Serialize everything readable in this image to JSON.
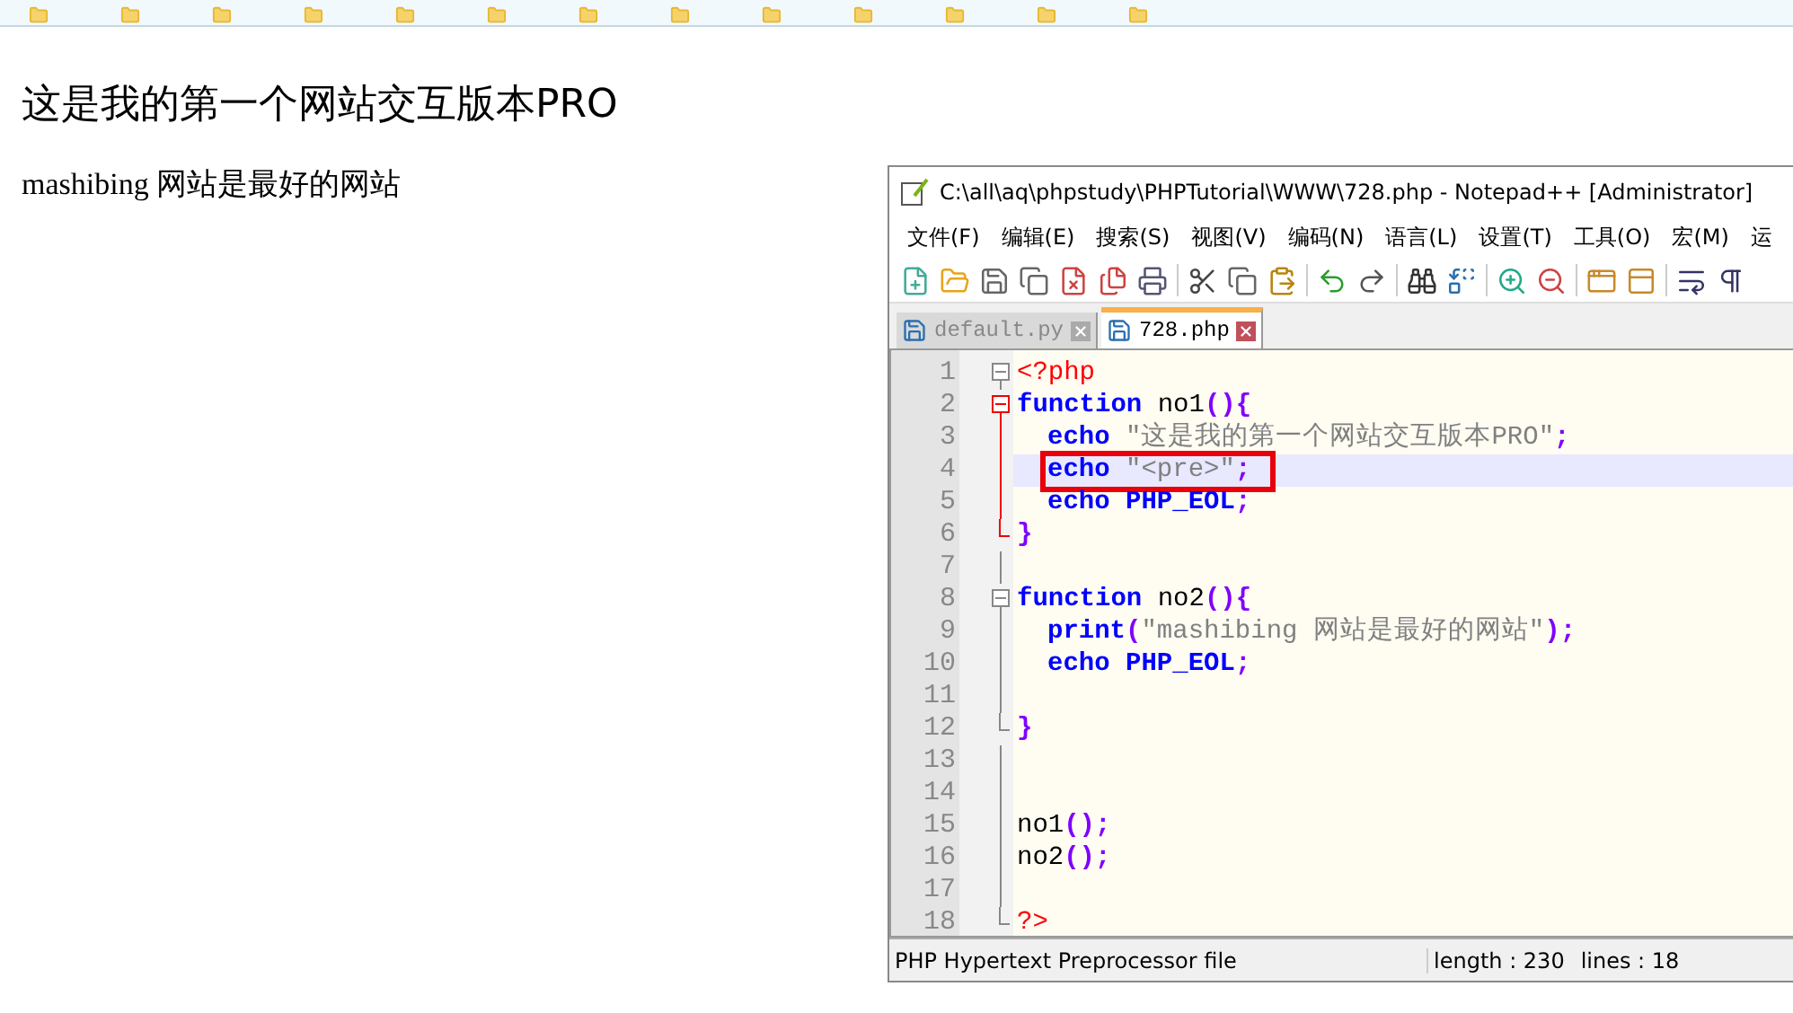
{
  "page": {
    "heading": "这是我的第一个网站交互版本PRO",
    "paragraph": "mashibing 网站是最好的网站"
  },
  "editor_window": {
    "title": "C:\\all\\aq\\phpstudy\\PHPTutorial\\WWW\\728.php - Notepad++ [Administrator]",
    "menu": [
      "文件(F)",
      "编辑(E)",
      "搜索(S)",
      "视图(V)",
      "编码(N)",
      "语言(L)",
      "设置(T)",
      "工具(O)",
      "宏(M)",
      "运"
    ],
    "tabs": [
      {
        "label": "default.py",
        "selected": false
      },
      {
        "label": "728.php",
        "selected": true
      }
    ],
    "lines": [
      {
        "number": "1",
        "selected": false,
        "kind": "start",
        "tokens": [
          {
            "text": "<?php",
            "kind": "tag"
          }
        ]
      },
      {
        "number": "2",
        "selected": false,
        "kind": "start",
        "fold_active": true,
        "tokens": [
          {
            "text": "function",
            "kind": "keyword"
          },
          {
            "text": " no1",
            "kind": "name"
          },
          {
            "text": "(){",
            "kind": "punct"
          }
        ]
      },
      {
        "number": "3",
        "selected": false,
        "kind": "body",
        "fold_active": true,
        "indent": true,
        "tokens": [
          {
            "text": "echo",
            "kind": "keyword"
          },
          {
            "text": " \"这是我的第一个网站交互版本PRO\"",
            "kind": "string"
          },
          {
            "text": ";",
            "kind": "punct"
          }
        ]
      },
      {
        "number": "4",
        "selected": true,
        "kind": "body",
        "fold_active": true,
        "indent": true,
        "annotated": true,
        "tokens": [
          {
            "text": "echo",
            "kind": "keyword"
          },
          {
            "text": " \"<pre>\"",
            "kind": "string"
          },
          {
            "text": ";",
            "kind": "punct"
          }
        ]
      },
      {
        "number": "5",
        "selected": false,
        "kind": "body",
        "fold_active": true,
        "indent": true,
        "tokens": [
          {
            "text": "echo",
            "kind": "keyword"
          },
          {
            "text": " PHP_EOL",
            "kind": "constant"
          },
          {
            "text": ";",
            "kind": "punct"
          }
        ]
      },
      {
        "number": "6",
        "selected": false,
        "kind": "end",
        "fold_active": true,
        "tokens": [
          {
            "text": "}",
            "kind": "punct"
          }
        ]
      },
      {
        "number": "7",
        "selected": false,
        "kind": "body"
      },
      {
        "number": "8",
        "selected": false,
        "kind": "start",
        "tokens": [
          {
            "text": "function",
            "kind": "keyword"
          },
          {
            "text": " no2",
            "kind": "name"
          },
          {
            "text": "(){",
            "kind": "punct"
          }
        ]
      },
      {
        "number": "9",
        "selected": false,
        "kind": "body",
        "indent": true,
        "tokens": [
          {
            "text": "print",
            "kind": "keyword"
          },
          {
            "text": "(",
            "kind": "punct"
          },
          {
            "text": "\"mashibing 网站是最好的网站\"",
            "kind": "string"
          },
          {
            "text": ");",
            "kind": "punct"
          }
        ]
      },
      {
        "number": "10",
        "selected": false,
        "kind": "body",
        "indent": true,
        "tokens": [
          {
            "text": "echo",
            "kind": "keyword"
          },
          {
            "text": " PHP_EOL",
            "kind": "constant"
          },
          {
            "text": ";",
            "kind": "punct"
          }
        ]
      },
      {
        "number": "11",
        "selected": false,
        "kind": "body"
      },
      {
        "number": "12",
        "selected": false,
        "kind": "end",
        "tokens": [
          {
            "text": "}",
            "kind": "punct"
          }
        ]
      },
      {
        "number": "13",
        "selected": false,
        "kind": "body"
      },
      {
        "number": "14",
        "selected": false,
        "kind": "body"
      },
      {
        "number": "15",
        "selected": false,
        "kind": "body",
        "tokens": [
          {
            "text": "no1",
            "kind": "name"
          },
          {
            "text": "();",
            "kind": "punct"
          }
        ]
      },
      {
        "number": "16",
        "selected": false,
        "kind": "body",
        "tokens": [
          {
            "text": "no2",
            "kind": "name"
          },
          {
            "text": "();",
            "kind": "punct"
          }
        ]
      },
      {
        "number": "17",
        "selected": false,
        "kind": "body"
      },
      {
        "number": "18",
        "selected": false,
        "kind": "end",
        "tokens": [
          {
            "text": "?>",
            "kind": "tag"
          }
        ]
      }
    ],
    "status_bar": {
      "file_type": "PHP Hypertext Preprocessor file",
      "length": "length : 230",
      "lines": "lines : 18"
    }
  }
}
